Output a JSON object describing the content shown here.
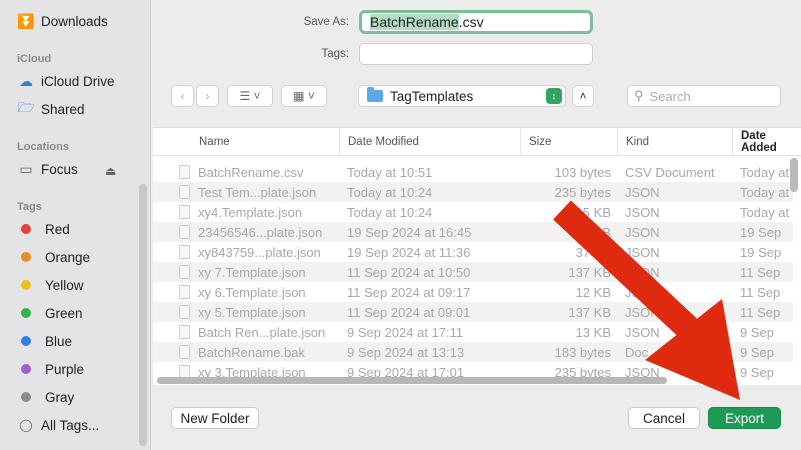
{
  "sidebar": {
    "downloads": "Downloads",
    "icloud_head": "iCloud",
    "icloud_drive": "iCloud Drive",
    "shared": "Shared",
    "locations_head": "Locations",
    "focus": "Focus",
    "tags_head": "Tags",
    "tags": [
      {
        "label": "Red",
        "color": "#ec3d3d"
      },
      {
        "label": "Orange",
        "color": "#f08a24"
      },
      {
        "label": "Yellow",
        "color": "#e8c21c"
      },
      {
        "label": "Green",
        "color": "#35b34a"
      },
      {
        "label": "Blue",
        "color": "#2f7fe6"
      },
      {
        "label": "Purple",
        "color": "#a35bd0"
      },
      {
        "label": "Gray",
        "color": "#8c8c8c"
      }
    ],
    "all_tags": "All Tags..."
  },
  "form": {
    "save_as_label": "Save As:",
    "filename_selected": "BatchRename",
    "filename_ext": ".csv",
    "tags_label": "Tags:"
  },
  "toolbar": {
    "location": "TagTemplates",
    "search_placeholder": "Search"
  },
  "columns": [
    "Name",
    "Date Modified",
    "Size",
    "Kind",
    "Date Added"
  ],
  "files": [
    {
      "name": "BatchRename.csv",
      "date": "Today at 10:51",
      "size": "103 bytes",
      "kind": "CSV Document",
      "added": "Today at"
    },
    {
      "name": "Test Tem...plate.json",
      "date": "Today at 10:24",
      "size": "235 bytes",
      "kind": "JSON",
      "added": "Today at"
    },
    {
      "name": "xy4.Template.json",
      "date": "Today at 10:24",
      "size": "15 KB",
      "kind": "JSON",
      "added": "Today at"
    },
    {
      "name": "23456546...plate.json",
      "date": "19 Sep 2024 at 16:45",
      "size": "KB",
      "kind": "JSON",
      "added": "19 Sep"
    },
    {
      "name": "xy843759...plate.json",
      "date": "19 Sep 2024 at 11:36",
      "size": "37 KB",
      "kind": "JSON",
      "added": "19 Sep"
    },
    {
      "name": "xy 7.Template.json",
      "date": "11 Sep 2024 at 10:50",
      "size": "137 KB",
      "kind": "JSON",
      "added": "11 Sep"
    },
    {
      "name": "xy 6.Template.json",
      "date": "11 Sep 2024 at 09:17",
      "size": "12 KB",
      "kind": "JSON",
      "added": "11 Sep"
    },
    {
      "name": "xy 5.Template.json",
      "date": "11 Sep 2024 at 09:01",
      "size": "137 KB",
      "kind": "JSON",
      "added": "11 Sep"
    },
    {
      "name": "Batch Ren...plate.json",
      "date": "9 Sep 2024 at 17:11",
      "size": "13 KB",
      "kind": "JSON",
      "added": "9 Sep"
    },
    {
      "name": "BatchRename.bak",
      "date": "9 Sep 2024 at 13:13",
      "size": "183 bytes",
      "kind": "Doc",
      "added": "9 Sep"
    },
    {
      "name": "xy 3.Template.json",
      "date": "9 Sep 2024 at 17:01",
      "size": "235 bytes",
      "kind": "JSON",
      "added": "9 Sep"
    }
  ],
  "buttons": {
    "new_folder": "New Folder",
    "cancel": "Cancel",
    "export": "Export"
  },
  "colors": {
    "accent": "#1d9a56",
    "arrow": "#e02a10"
  }
}
